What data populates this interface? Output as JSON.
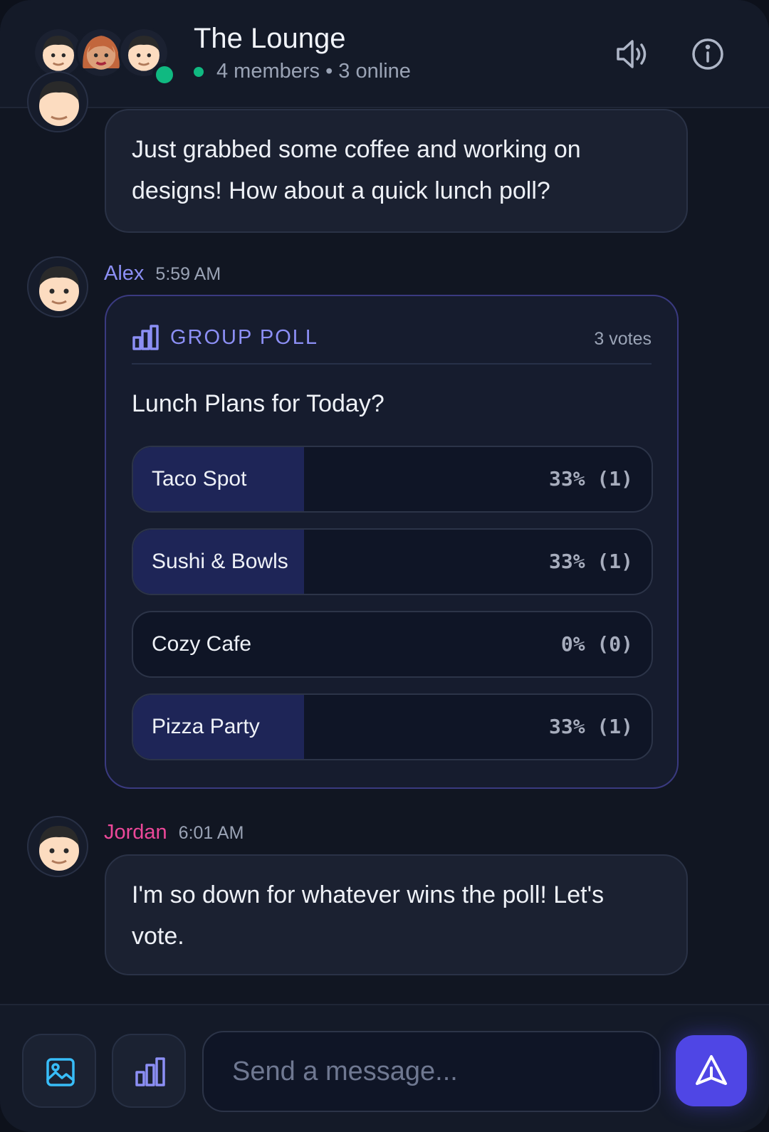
{
  "header": {
    "title": "The Lounge",
    "subtitle": "4 members • 3 online",
    "online_color": "#10b981"
  },
  "messages": [
    {
      "author": "",
      "time": "",
      "text": "Just grabbed some coffee and working on designs! How about a quick lunch poll?"
    },
    {
      "author": "Alex",
      "author_color": "#8c8ff5",
      "time": "5:59 AM",
      "poll": {
        "label": "GROUP POLL",
        "votes": "3 votes",
        "question": "Lunch Plans for Today?",
        "options": [
          {
            "name": "Taco Spot",
            "result": "33% (1)",
            "share": 0.33
          },
          {
            "name": "Sushi & Bowls",
            "result": "33% (1)",
            "share": 0.33
          },
          {
            "name": "Cozy Cafe",
            "result": "0% (0)",
            "share": 0
          },
          {
            "name": "Pizza Party",
            "result": "33% (1)",
            "share": 0.33
          }
        ]
      }
    },
    {
      "author": "Jordan",
      "author_color": "#ec4899",
      "time": "6:01 AM",
      "text": "I'm so down for whatever wins the poll! Let's vote."
    }
  ],
  "composer": {
    "placeholder": "Send a message...",
    "accent": "#4f46e5"
  },
  "icons": {
    "speaker": "speaker-icon",
    "info": "info-icon",
    "poll": "bar-chart-icon",
    "image": "image-icon",
    "send": "send-icon"
  }
}
